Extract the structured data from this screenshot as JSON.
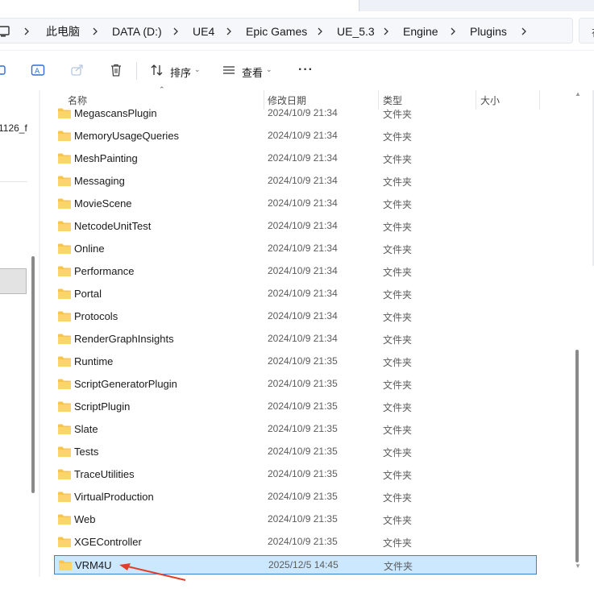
{
  "breadcrumb": {
    "items": [
      "此电脑",
      "DATA (D:)",
      "UE4",
      "Epic Games",
      "UE_5.3",
      "Engine",
      "Plugins"
    ],
    "search_stub": "在"
  },
  "toolbar": {
    "sort_label": "排序",
    "view_label": "查看",
    "more_label": "···"
  },
  "nav": {
    "partial_item": "1126_f"
  },
  "columns": {
    "name": "名称",
    "date": "修改日期",
    "type": "类型",
    "size": "大小"
  },
  "files": [
    {
      "name": "MegascansPlugin",
      "date": "2024/10/9 21:34",
      "type": "文件夹"
    },
    {
      "name": "MemoryUsageQueries",
      "date": "2024/10/9 21:34",
      "type": "文件夹"
    },
    {
      "name": "MeshPainting",
      "date": "2024/10/9 21:34",
      "type": "文件夹"
    },
    {
      "name": "Messaging",
      "date": "2024/10/9 21:34",
      "type": "文件夹"
    },
    {
      "name": "MovieScene",
      "date": "2024/10/9 21:34",
      "type": "文件夹"
    },
    {
      "name": "NetcodeUnitTest",
      "date": "2024/10/9 21:34",
      "type": "文件夹"
    },
    {
      "name": "Online",
      "date": "2024/10/9 21:34",
      "type": "文件夹"
    },
    {
      "name": "Performance",
      "date": "2024/10/9 21:34",
      "type": "文件夹"
    },
    {
      "name": "Portal",
      "date": "2024/10/9 21:34",
      "type": "文件夹"
    },
    {
      "name": "Protocols",
      "date": "2024/10/9 21:34",
      "type": "文件夹"
    },
    {
      "name": "RenderGraphInsights",
      "date": "2024/10/9 21:34",
      "type": "文件夹"
    },
    {
      "name": "Runtime",
      "date": "2024/10/9 21:35",
      "type": "文件夹"
    },
    {
      "name": "ScriptGeneratorPlugin",
      "date": "2024/10/9 21:35",
      "type": "文件夹"
    },
    {
      "name": "ScriptPlugin",
      "date": "2024/10/9 21:35",
      "type": "文件夹"
    },
    {
      "name": "Slate",
      "date": "2024/10/9 21:35",
      "type": "文件夹"
    },
    {
      "name": "Tests",
      "date": "2024/10/9 21:35",
      "type": "文件夹"
    },
    {
      "name": "TraceUtilities",
      "date": "2024/10/9 21:35",
      "type": "文件夹"
    },
    {
      "name": "VirtualProduction",
      "date": "2024/10/9 21:35",
      "type": "文件夹"
    },
    {
      "name": "Web",
      "date": "2024/10/9 21:35",
      "type": "文件夹"
    },
    {
      "name": "XGEController",
      "date": "2024/10/9 21:35",
      "type": "文件夹"
    },
    {
      "name": "VRM4U",
      "date": "2025/12/5 14:45",
      "type": "文件夹",
      "selected": true
    }
  ],
  "colors": {
    "selection_bg": "#cce8ff",
    "selection_border": "#3d7fd8",
    "folder_yellow": "#f8c548",
    "annotation_arrow": "#e0402a"
  },
  "icons": {
    "toolbar": [
      "share-stub-icon",
      "rename-icon",
      "share-icon",
      "delete-icon",
      "sort-icon",
      "view-icon",
      "more-icon"
    ],
    "folder": "folder-icon",
    "annotation": "red-arrow-icon"
  }
}
